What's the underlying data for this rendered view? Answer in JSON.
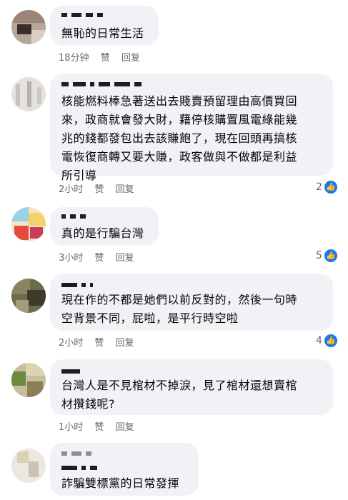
{
  "comments": [
    {
      "text": "無恥的日常生活",
      "time": "18分钟",
      "like": "赞",
      "reply": "回复",
      "reactions": ""
    },
    {
      "text": "核能燃料棒急著送出去賤賣預留理由高價買回\n來，政商就會發大財，藉停核購置風電綠能幾\n兆的錢都發包出去該賺飽了，現在回頭再搞核\n電恢復商轉又要大賺，政客做與不做都是利益\n所引導",
      "time": "2小时",
      "like": "赞",
      "reply": "回复",
      "reactions": "2"
    },
    {
      "text": "真的是行騙台灣",
      "time": "3小时",
      "like": "赞",
      "reply": "回复",
      "reactions": "5"
    },
    {
      "text": "現在作的不都是她們以前反對的，然後一句時\n空背景不同，屁啦，是平行時空啦",
      "time": "2小时",
      "like": "赞",
      "reply": "回复",
      "reactions": "4"
    },
    {
      "text": "台灣人是不見棺材不掉淚，見了棺材還想賣棺\n材攢錢呢?",
      "time": "1小时",
      "like": "赞",
      "reply": "回复",
      "reactions": ""
    },
    {
      "text": "詐騙雙標黨的日常發揮",
      "time": "",
      "like": "",
      "reply": "",
      "reactions": ""
    }
  ],
  "icons": {
    "reaction": "thumbs-up-icon"
  },
  "colors": {
    "bubble": "#f0f2f5",
    "meta": "#65676b",
    "like": "#1877f2"
  }
}
